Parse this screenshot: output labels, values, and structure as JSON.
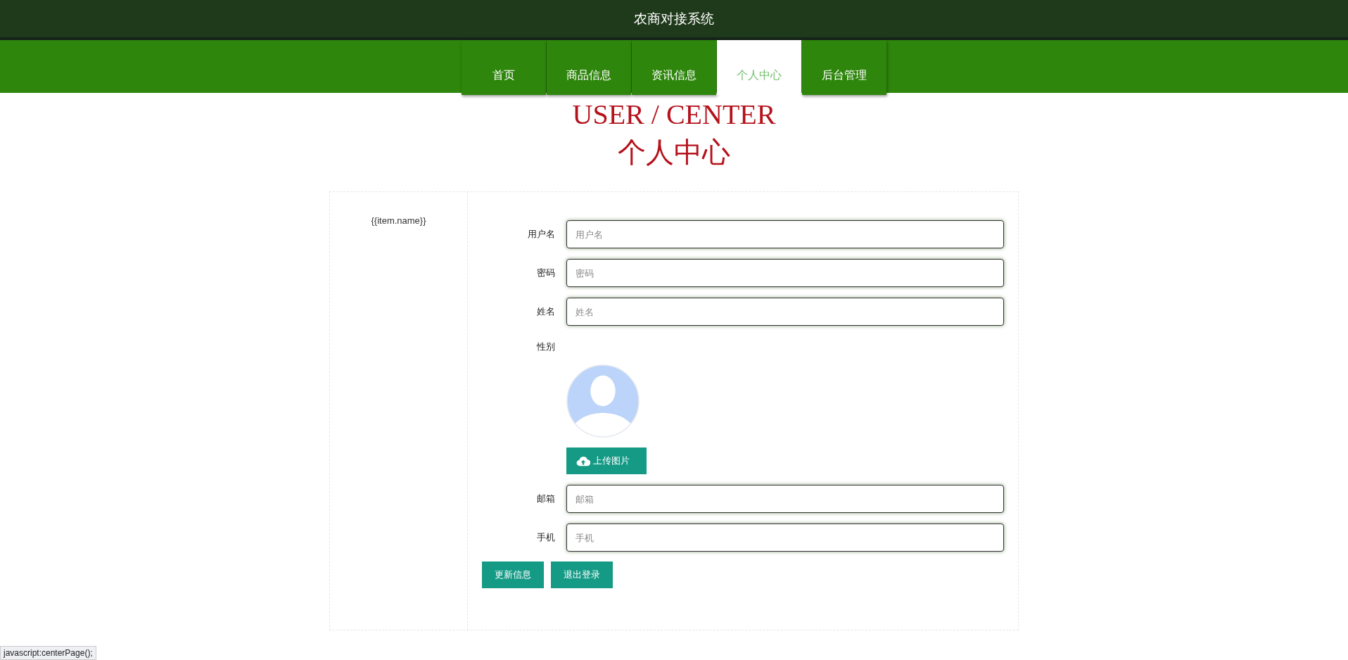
{
  "header": {
    "title": "农商对接系统"
  },
  "nav": [
    {
      "label": "首页",
      "selected": false
    },
    {
      "label": "商品信息",
      "selected": false
    },
    {
      "label": "资讯信息",
      "selected": false
    },
    {
      "label": "个人中心",
      "selected": true
    },
    {
      "label": "后台管理",
      "selected": false
    }
  ],
  "heading": {
    "english": "USER / CENTER",
    "chinese": "个人中心"
  },
  "sidebar": {
    "items": [
      "{{item.name}}"
    ]
  },
  "form": {
    "fields": [
      {
        "kind": "text",
        "label": "用户名",
        "placeholder": "用户名"
      },
      {
        "kind": "text",
        "label": "密码",
        "placeholder": "密码"
      },
      {
        "kind": "text",
        "label": "姓名",
        "placeholder": "姓名"
      },
      {
        "kind": "label",
        "label": "性别"
      },
      {
        "kind": "image",
        "button": "上传图片"
      },
      {
        "kind": "text",
        "label": "邮箱",
        "placeholder": "邮箱"
      },
      {
        "kind": "text",
        "label": "手机",
        "placeholder": "手机"
      }
    ],
    "buttons": [
      "更新信息",
      "退出登录"
    ]
  },
  "status_bar": {
    "url": "javascript:centerPage();"
  }
}
